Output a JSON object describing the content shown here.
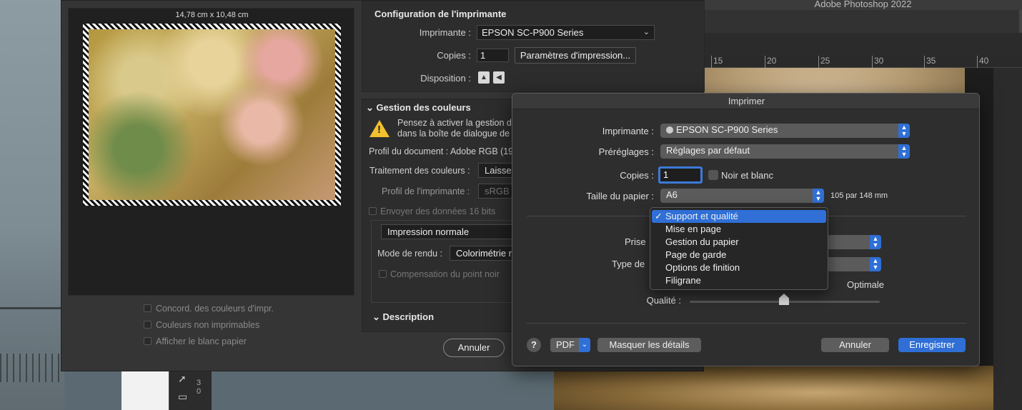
{
  "photoshop": {
    "app_title": "Adobe Photoshop 2022",
    "ruler_ticks": [
      "15",
      "20",
      "25",
      "30",
      "35",
      "40"
    ],
    "vertical_ruler": [
      "3",
      "0"
    ]
  },
  "print_settings": {
    "preview_dimensions": "14,78 cm x 10,48 cm",
    "printer_config_title": "Configuration de l'imprimante",
    "printer_label": "Imprimante :",
    "printer_value": "EPSON SC-P900 Series",
    "copies_label": "Copies :",
    "copies_value": "1",
    "print_settings_button": "Paramètres d'impression...",
    "layout_label": "Disposition :",
    "color_mgmt_title": "Gestion des couleurs",
    "warning_line1": "Pensez à activer la gestion d",
    "warning_line2": "dans la boîte de dialogue de",
    "doc_profile": "Profil du document : Adobe RGB (19",
    "color_handling_label": "Traitement des couleurs :",
    "color_handling_value": "Laisser",
    "printer_profile_label": "Profil de l'imprimante :",
    "printer_profile_value": "sRGB IE",
    "send_16bit": "Envoyer des données 16 bits",
    "normal_print": "Impression normale",
    "render_mode_label": "Mode de rendu :",
    "render_mode_value": "Colorimétrie re",
    "black_point": "Compensation du point noir",
    "description_title": "Description",
    "match_colors": "Concord. des couleurs d'impr.",
    "gamut_warning": "Couleurs non imprimables",
    "show_paper_white": "Afficher le blanc papier",
    "cancel": "Annuler"
  },
  "mac_dialog": {
    "title": "Imprimer",
    "printer_label": "Imprimante :",
    "printer_value": "EPSON SC-P900 Series",
    "presets_label": "Préréglages :",
    "presets_value": "Réglages par défaut",
    "copies_label": "Copies :",
    "copies_value": "1",
    "bw_label": "Noir et blanc",
    "paper_size_label": "Taille du papier :",
    "paper_size_value": "A6",
    "paper_size_dims": "105 par 148 mm",
    "feed_label": "Prise",
    "media_type_label": "Type de",
    "quality_label": "Qualité :",
    "quality_max_label": "Optimale",
    "help": "?",
    "pdf_button": "PDF",
    "hide_details_button": "Masquer les détails",
    "cancel_button": "Annuler",
    "save_button": "Enregistrer",
    "menu": {
      "items": [
        "Support et qualité",
        "Mise en page",
        "Gestion du papier",
        "Page de garde",
        "Options de finition",
        "Filigrane"
      ],
      "selected_check": "✓"
    }
  }
}
